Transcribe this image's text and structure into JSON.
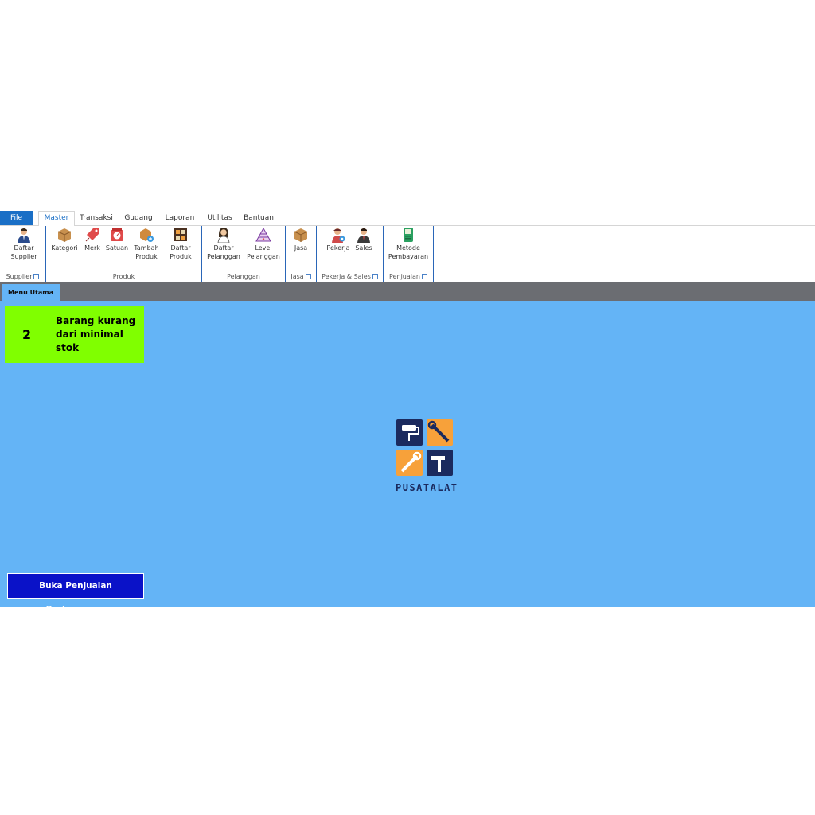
{
  "tabs": {
    "file": "File",
    "items": [
      "Master",
      "Transaksi",
      "Gudang",
      "Laporan",
      "Utilitas",
      "Bantuan"
    ],
    "active": "Master"
  },
  "ribbon": {
    "groups": {
      "supplier": {
        "label": "Supplier",
        "buttons": [
          {
            "l1": "Daftar",
            "l2": "Supplier",
            "icon": "supplier-person-icon"
          }
        ]
      },
      "produk": {
        "label": "Produk",
        "buttons": [
          {
            "l1": "Kategori",
            "l2": "",
            "icon": "box-icon"
          },
          {
            "l1": "Merk",
            "l2": "",
            "icon": "price-tag-icon"
          },
          {
            "l1": "Satuan",
            "l2": "",
            "icon": "weighing-scale-icon"
          },
          {
            "l1": "Tambah",
            "l2": "Produk",
            "icon": "add-box-icon"
          },
          {
            "l1": "Daftar",
            "l2": "Produk",
            "icon": "product-list-icon"
          }
        ]
      },
      "pelanggan": {
        "label": "Pelanggan",
        "buttons": [
          {
            "l1": "Daftar",
            "l2": "Pelanggan",
            "icon": "customer-woman-icon"
          },
          {
            "l1": "Level",
            "l2": "Pelanggan",
            "icon": "level-triangle-icon"
          }
        ]
      },
      "jasa": {
        "label": "Jasa",
        "buttons": [
          {
            "l1": "Jasa",
            "l2": "",
            "icon": "service-box-icon"
          }
        ]
      },
      "pekerja": {
        "label": "Pekerja & Sales",
        "buttons": [
          {
            "l1": "Pekerja",
            "l2": "",
            "icon": "worker-icon"
          },
          {
            "l1": "Sales",
            "l2": "",
            "icon": "sales-person-icon"
          }
        ]
      },
      "penjualan": {
        "label": "Penjualan",
        "buttons": [
          {
            "l1": "Metode",
            "l2": "Pembayaran",
            "icon": "payment-terminal-icon"
          }
        ]
      }
    }
  },
  "doc_tab": "Menu Utama",
  "alert": {
    "count": "2",
    "text": "Barang kurang dari minimal stok"
  },
  "logo": {
    "name": "PUSATALAT",
    "colors": {
      "navy": "#1b2a5e",
      "orange": "#f7a13a"
    }
  },
  "action_button": "Buka Penjualan Berlangsung",
  "colors": {
    "main_bg": "#64b4f6",
    "alert_bg": "#80ff00",
    "action_bg": "#0a12c8",
    "file_tab": "#1a6fc6"
  }
}
